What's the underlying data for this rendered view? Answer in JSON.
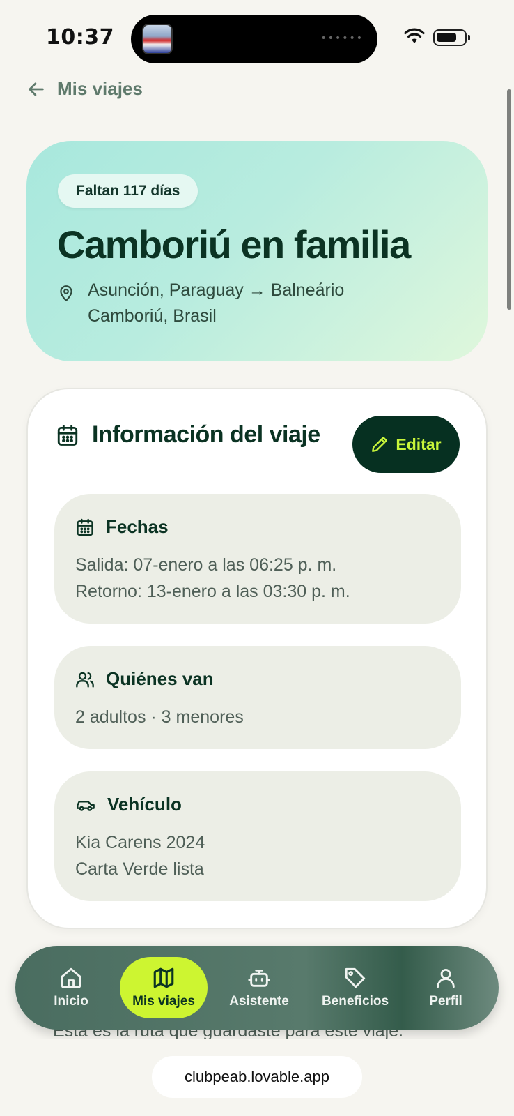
{
  "status_bar": {
    "time": "10:37"
  },
  "nav_back": {
    "label": "Mis viajes"
  },
  "trip": {
    "countdown": "Faltan 117 días",
    "title": "Camboriú en familia",
    "route": "Asunción, Paraguay → Balneário Camboriú, Brasil"
  },
  "info": {
    "title": "Información del viaje",
    "edit_label": "Editar",
    "dates": {
      "title": "Fechas",
      "departure": "Salida: 07-enero a las 06:25 p. m.",
      "return": "Retorno: 13-enero a las 03:30 p. m."
    },
    "travelers": {
      "title": "Quiénes van",
      "summary": "2 adultos · 3 menores"
    },
    "vehicle": {
      "title": "Vehículo",
      "model": "Kia Carens 2024",
      "document": "Carta Verde lista"
    }
  },
  "route_note": "Esta es la ruta que guardaste para este viaje.",
  "bottom_nav": {
    "items": [
      {
        "label": "Inicio",
        "icon": "home-icon"
      },
      {
        "label": "Mis viajes",
        "icon": "map-icon",
        "active": true
      },
      {
        "label": "Asistente",
        "icon": "bot-icon"
      },
      {
        "label": "Beneficios",
        "icon": "tag-icon"
      },
      {
        "label": "Perfil",
        "icon": "user-icon"
      }
    ]
  },
  "browser": {
    "url": "clubpeab.lovable.app"
  },
  "colors": {
    "background": "#f6f5f0",
    "primary_dark": "#063021",
    "accent_lime": "#cdf531",
    "hero_gradient_start": "#a8e8dd",
    "hero_gradient_end": "#dff7dc",
    "section_bg": "#eceee6"
  }
}
